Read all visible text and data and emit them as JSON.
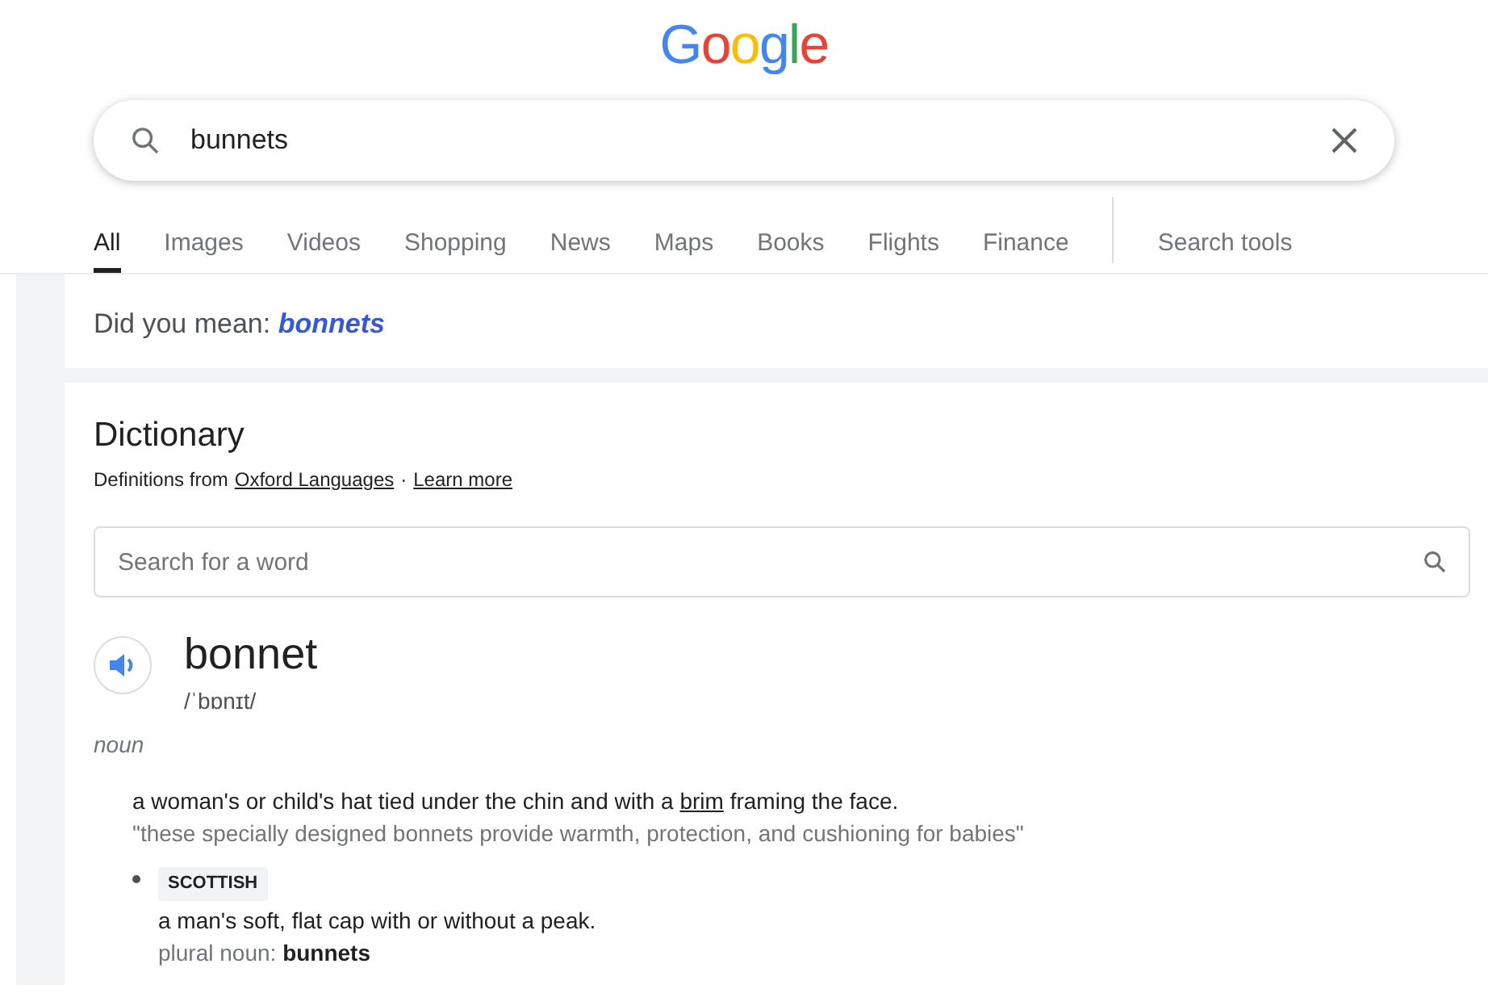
{
  "logo": "Google",
  "search": {
    "value": "bunnets"
  },
  "tabs": [
    {
      "label": "All",
      "selected": true
    },
    {
      "label": "Images",
      "selected": false
    },
    {
      "label": "Videos",
      "selected": false
    },
    {
      "label": "Shopping",
      "selected": false
    },
    {
      "label": "News",
      "selected": false
    },
    {
      "label": "Maps",
      "selected": false
    },
    {
      "label": "Books",
      "selected": false
    },
    {
      "label": "Flights",
      "selected": false
    },
    {
      "label": "Finance",
      "selected": false
    }
  ],
  "search_tools": "Search tools",
  "did_you_mean": {
    "prefix": "Did you mean:",
    "suggestion": "bonnets"
  },
  "dictionary": {
    "title": "Dictionary",
    "source_prefix": "Definitions from",
    "source_link": "Oxford Languages",
    "separator": "·",
    "learn_more": "Learn more",
    "word_search": {
      "placeholder": "Search for a word"
    },
    "headword": "bonnet",
    "pronunciation": "/ˈbɒnɪt/",
    "part_of_speech": "noun",
    "senses": [
      {
        "kind": "main",
        "before": "a woman's or child's hat tied under the chin and with a",
        "link": "brim",
        "after": "framing the face.",
        "example": "\"these specially designed bonnets provide warmth, protection, and cushioning for babies\""
      },
      {
        "kind": "sub",
        "label": "SCOTTISH",
        "definition": "a man's soft, flat cap with or without a peak.",
        "plural_label": "plural noun:",
        "plural": "bunnets"
      }
    ]
  }
}
